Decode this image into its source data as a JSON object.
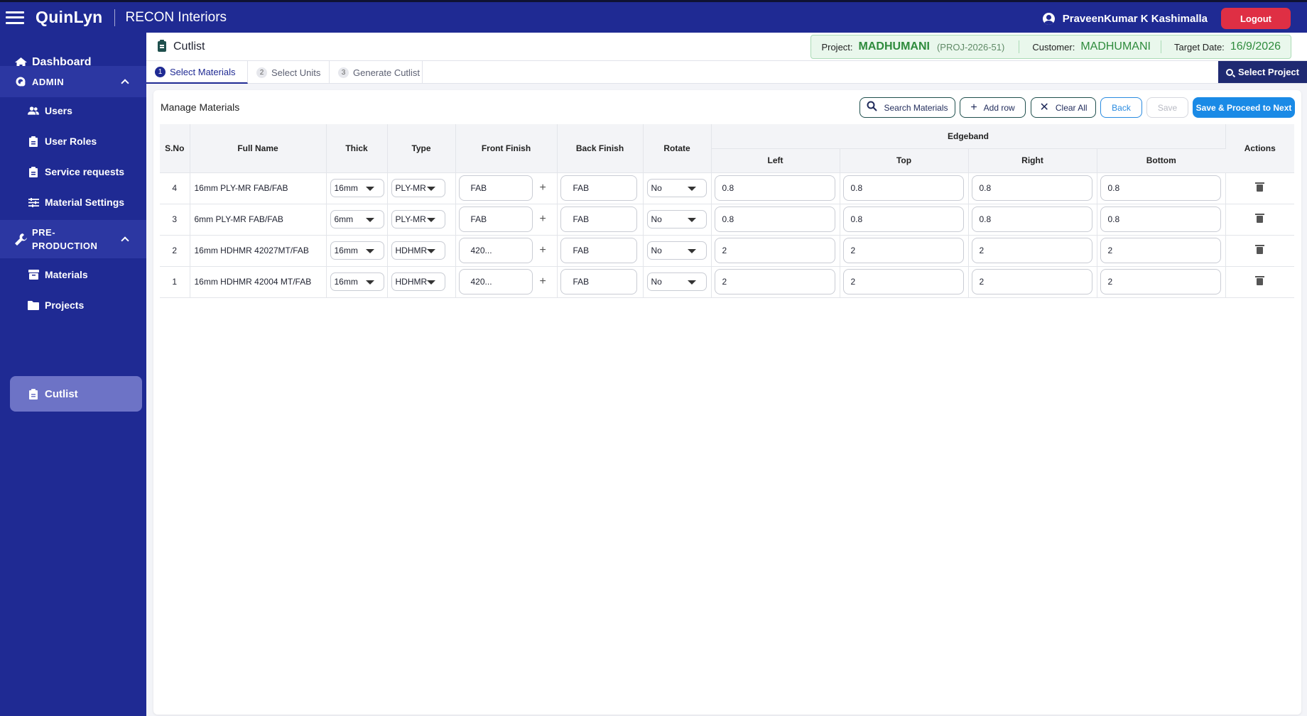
{
  "app": {
    "brand": "QuinLyn",
    "company": "RECON Interiors"
  },
  "user": {
    "name": "PraveenKumar K Kashimalla",
    "logout_label": "Logout"
  },
  "sidebar": {
    "dashboard": "Dashboard",
    "admin_group": "ADMIN",
    "admin_items": [
      "Users",
      "User Roles",
      "Service requests",
      "Material Settings"
    ],
    "preproduction_group": "PRE-\nPRODUCTION",
    "preproduction_items": [
      "Materials",
      "Projects",
      "Cutlist"
    ]
  },
  "page": {
    "title": "Cutlist"
  },
  "project_info": {
    "project_label": "Project:",
    "project_name": "MADHUMANI",
    "project_code": "(PROJ-2026-51)",
    "customer_label": "Customer:",
    "customer_name": "MADHUMANI",
    "target_label": "Target Date:",
    "target_date": "16/9/2026"
  },
  "tabs": [
    {
      "num": "1",
      "label": "Select Materials"
    },
    {
      "num": "2",
      "label": "Select Units"
    },
    {
      "num": "3",
      "label": "Generate Cutlist"
    }
  ],
  "select_project_label": "Select Project",
  "card": {
    "title": "Manage Materials",
    "buttons": {
      "search": "Search Materials",
      "add_row": "Add row",
      "clear_all": "Clear All",
      "back": "Back",
      "save": "Save",
      "proceed": "Save & Proceed to Next"
    }
  },
  "table": {
    "headers": {
      "sno": "S.No",
      "full_name": "Full Name",
      "thick": "Thick",
      "type": "Type",
      "front_finish": "Front Finish",
      "back_finish": "Back Finish",
      "rotate": "Rotate",
      "edgeband": "Edgeband",
      "left": "Left",
      "top": "Top",
      "right": "Right",
      "bottom": "Bottom",
      "actions": "Actions"
    },
    "rows": [
      {
        "sno": "4",
        "name": "16mm PLY-MR FAB/FAB",
        "thick": "16mm",
        "type": "PLY-MR",
        "front": "FAB",
        "back": "FAB",
        "rotate": "No",
        "left": "0.8",
        "top": "0.8",
        "right": "0.8",
        "bottom": "0.8"
      },
      {
        "sno": "3",
        "name": "6mm PLY-MR FAB/FAB",
        "thick": "6mm",
        "type": "PLY-MR",
        "front": "FAB",
        "back": "FAB",
        "rotate": "No",
        "left": "0.8",
        "top": "0.8",
        "right": "0.8",
        "bottom": "0.8"
      },
      {
        "sno": "2",
        "name": "16mm HDHMR 42027MT/FAB",
        "thick": "16mm",
        "type": "HDHMR",
        "front": "420...",
        "back": "FAB",
        "rotate": "No",
        "left": "2",
        "top": "2",
        "right": "2",
        "bottom": "2"
      },
      {
        "sno": "1",
        "name": "16mm HDHMR 42004 MT/FAB",
        "thick": "16mm",
        "type": "HDHMR",
        "front": "420...",
        "back": "FAB",
        "rotate": "No",
        "left": "2",
        "top": "2",
        "right": "2",
        "bottom": "2"
      }
    ]
  },
  "colors": {
    "sidebar_bg": "#1f2a93",
    "accent": "#1a8ae6",
    "logout": "#df2f44",
    "project_green": "#2e8b3c"
  }
}
